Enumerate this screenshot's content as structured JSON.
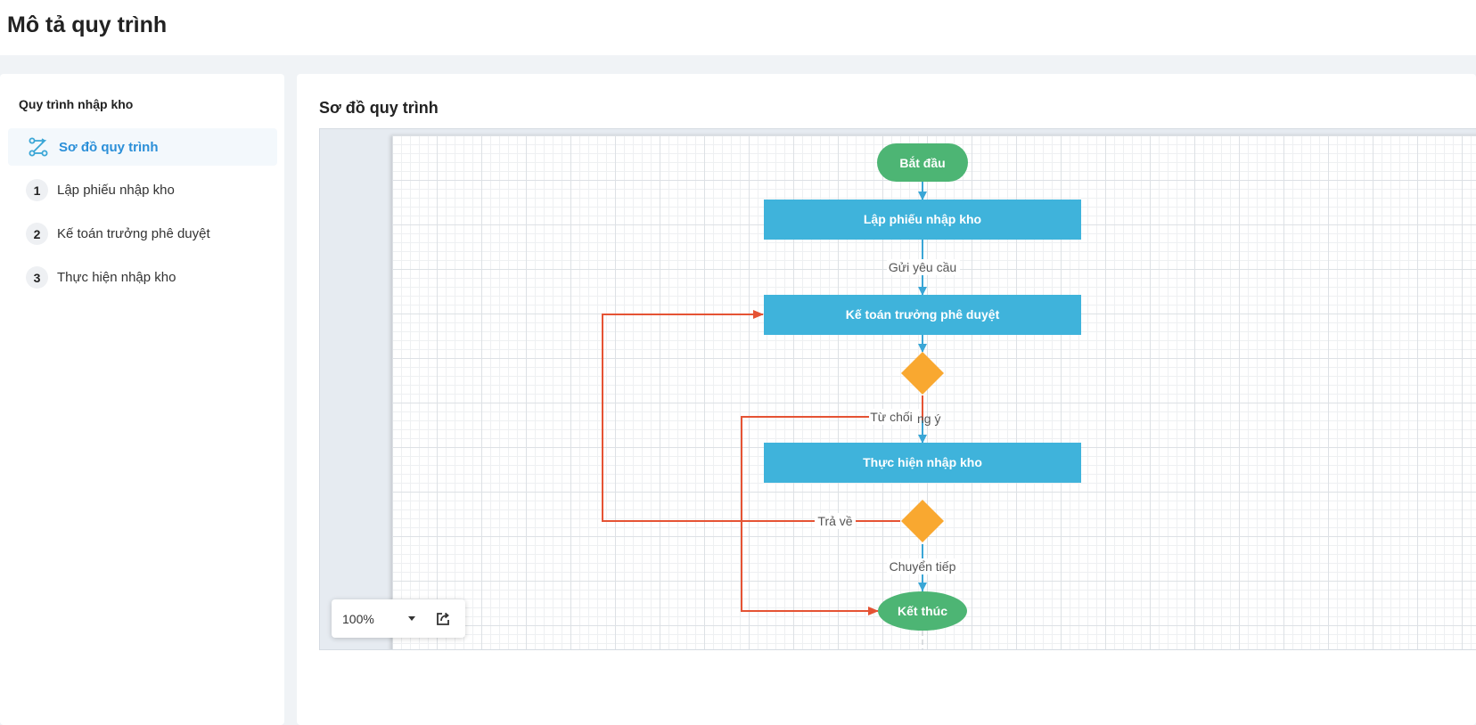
{
  "page": {
    "title": "Mô tả quy trình"
  },
  "sidebar": {
    "heading": "Quy trình nhập kho",
    "active_item": {
      "label": "Sơ đồ quy trình",
      "icon": "flow-route-icon"
    },
    "steps": [
      {
        "number": "1",
        "label": "Lập phiếu nhập kho"
      },
      {
        "number": "2",
        "label": "Kế toán trưởng phê duyệt"
      },
      {
        "number": "3",
        "label": "Thực hiện nhập kho"
      }
    ]
  },
  "main": {
    "title": "Sơ đồ quy trình",
    "zoom": {
      "value": "100%",
      "export_icon": "export-icon"
    }
  },
  "diagram": {
    "colors": {
      "terminal": "#4db574",
      "task": "#3fb3db",
      "decision": "#f9a830",
      "flow": "#3aa6d6",
      "return": "#e55334"
    },
    "nodes": {
      "start": "Bắt đầu",
      "task1": "Lập phiếu nhập kho",
      "task2": "Kế toán trưởng phê duyệt",
      "task3": "Thực hiện nhập kho",
      "end": "Kết thúc"
    },
    "edges": {
      "send": "Gửi yêu cầu",
      "reject": "Từ chối",
      "agree_partial": "ng ý",
      "return": "Trả về",
      "forward": "Chuyển tiếp"
    }
  }
}
